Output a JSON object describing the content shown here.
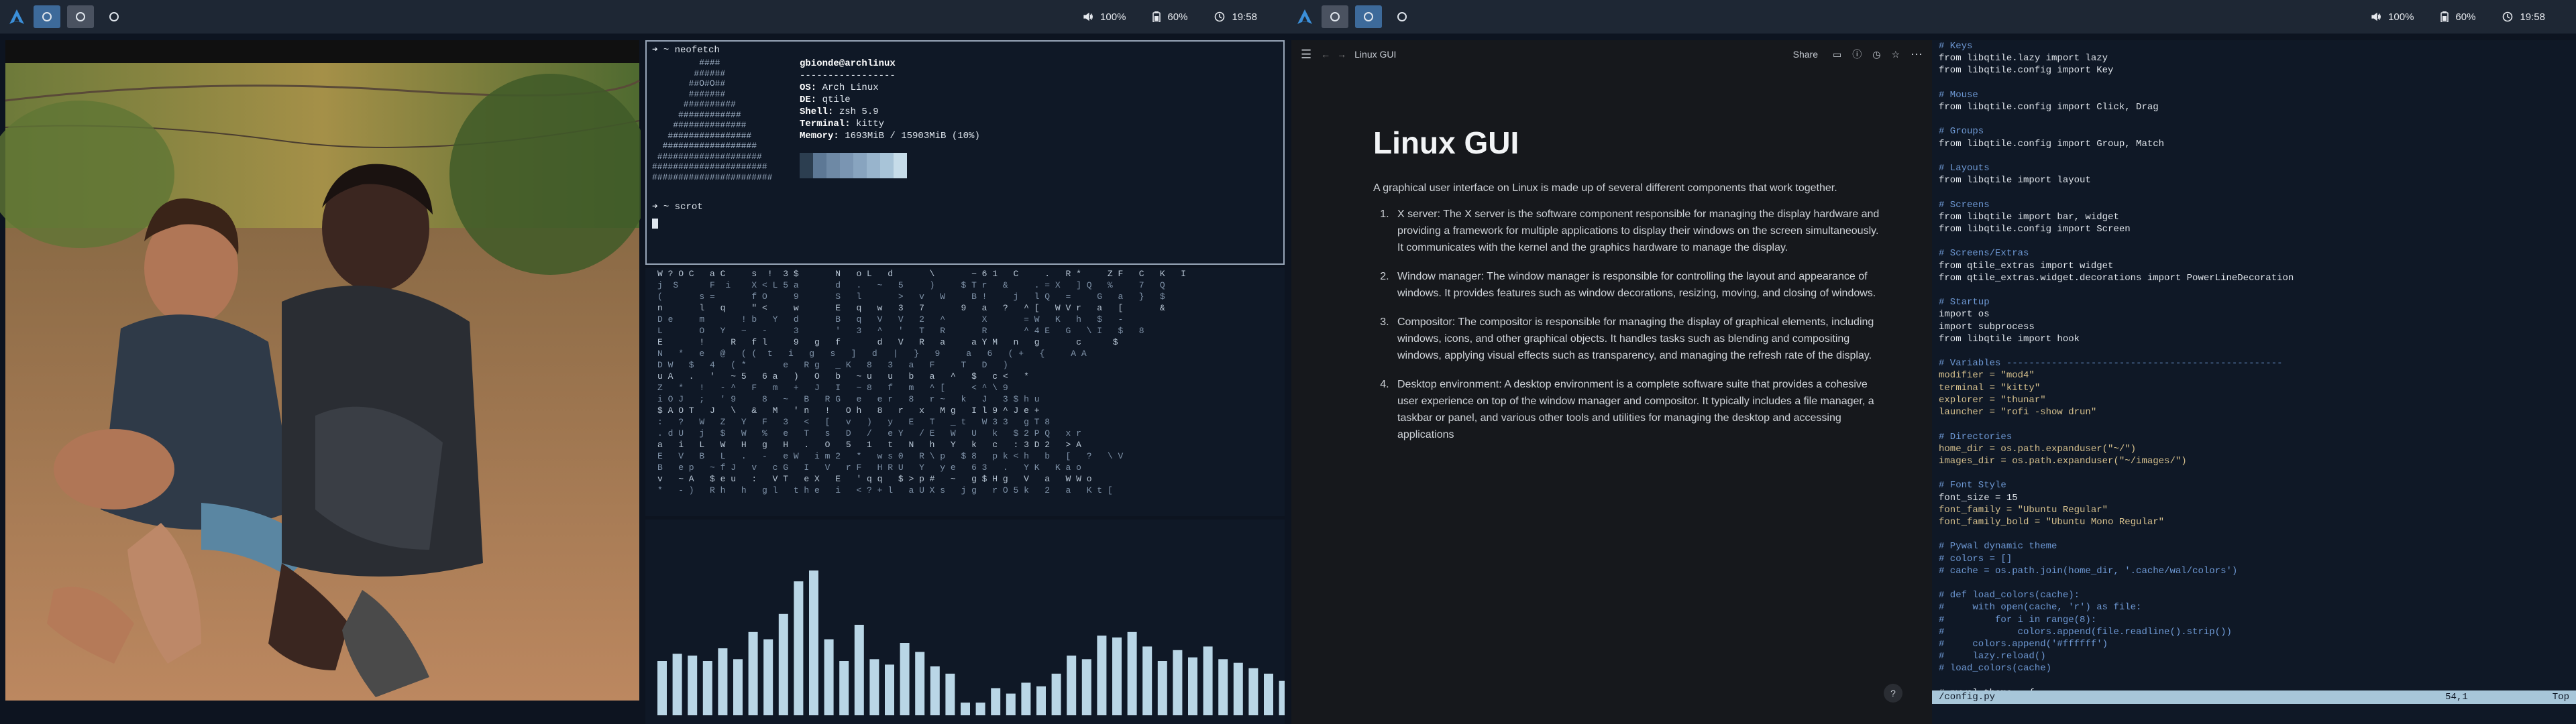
{
  "bar_left": {
    "workspaces": [
      "ws-1",
      "ws-2",
      "ws-3"
    ],
    "volume": "100%",
    "battery": "60%",
    "clock": "19:58"
  },
  "bar_right": {
    "workspaces": [
      "ws-1",
      "ws-2",
      "ws-3"
    ],
    "volume": "100%",
    "battery": "60%",
    "clock": "19:58"
  },
  "terminal": {
    "cmd1": "➜  ~ neofetch",
    "user_host": "gbionde@archlinux",
    "separator": "-----------------",
    "os_label": "OS:",
    "os": "Arch Linux",
    "de_label": "DE:",
    "de": "qtile",
    "shell_label": "Shell:",
    "shell": "zsh 5.9",
    "term_label": "Terminal:",
    "term_val": "kitty",
    "mem_label": "Memory:",
    "mem": "1693MiB / 15903MiB (10%)",
    "cmd2": "➜  ~ scrot",
    "swatches": [
      "#2c3e50",
      "#5d7895",
      "#6e89a5",
      "#7a95b2",
      "#88a4bf",
      "#98b4cc",
      "#a8c4d8",
      "#c6dce9"
    ]
  },
  "matrix_lines": [
    "W ? O C   a C     s  !  3 $       N   o L   d       \\       ~ 6 1   C     .   R *     Z F   C   K   I",
    "j  S      F  i    X < L 5 a       d   .   ~   5     )     $ T r   &     . = X   ] Q   %     7   Q",
    "(       s =       f O     9       S   l       >   v   W     B !     j   l Q   =     G   a   }   $",
    "n       l   q     \" <     w       E   q   w   3   7       9   a   ?   ^ [   W V r   a   [       &",
    "D e     m       ! b   Y   d       B   q   V   V   2   ^       X       = W   K   h   $   -",
    "L       O   Y   ~   -     3       '   3   ^   '   T   R       R       ^ 4 E   G   \\ I   $   8",
    "E       !     R   f l     9   g   f       d   V   R   a     a Y M   n   g       c      $",
    "N   *   e   @   ( (  t   i   g   s   ]   d   |   }   9     a   6   ( +   {     A A",
    "D W   $   4   ( *       e   R g   _ K   8   3   a   F     T   D   )",
    "u A   .   '   ~ 5   6 a   )   O   b   ~ u   u   b   a   ^   $   c <   *",
    "Z   *   !   - ^   F   m   +   J   I   ~ 8   f   m   ^ [     < ^ \\ 9",
    "i O J   ;   ' 9     8   ~   B   R G   e   e r   8   r ~   k   J   3 $ h u",
    "$ A O T   J   \\   &   M   ' n   !   O h   8   r   x   M g   I l 9 ^ J e +",
    ":   ?   W   Z   Y   F   3   <   [   v   )   y   E   T   _ t   W 3 3   g T 8",
    ". d U   j   $   W   %   e   T   s   D   /   e Y   / E   W   U   k   $ 2 P Q   x r",
    "a   i   L   W   H   g   H   .   O   5   1   t   N   h   Y   k   c   : 3 D 2   > A",
    "E   V   B   L   .   -   e W   i m 2   *   w s 0   R \\ p   $ 8   p k < h   b   [   ?   \\ V",
    "B   e p   ~ f J   v   c G   I   V   r F   H R U   Y   y e   6 3   .   Y K   K a o",
    "v   ~ A   $ e u   :   V T   e X   E   ' q q   $ > p #   ~   g $ H g   V   a   W W o",
    "*   - )   R h   h   g l   t h e   i   < ? + l   a U X s   j g   r O 5 k   2   a   K t ["
  ],
  "viz_bars": [
    0.3,
    0.34,
    0.33,
    0.3,
    0.37,
    0.31,
    0.46,
    0.42,
    0.56,
    0.74,
    0.8,
    0.42,
    0.3,
    0.5,
    0.31,
    0.28,
    0.4,
    0.35,
    0.27,
    0.23,
    0.07,
    0.07,
    0.15,
    0.12,
    0.18,
    0.16,
    0.23,
    0.33,
    0.31,
    0.44,
    0.43,
    0.46,
    0.38,
    0.3,
    0.36,
    0.32,
    0.38,
    0.31,
    0.29,
    0.26,
    0.23,
    0.19
  ],
  "notes": {
    "breadcrumb": "Linux GUI",
    "share": "Share",
    "title": "Linux GUI",
    "intro": "A graphical user interface on Linux is made up of several different components that work together.",
    "items": [
      "X server: The X server is the software component responsible for managing the display hardware and providing a framework for multiple applications to display their windows on the screen simultaneously. It communicates with the kernel and the graphics hardware to manage the display.",
      "Window manager: The window manager is responsible for controlling the layout and appearance of windows. It provides features such as window decorations, resizing, moving, and closing of windows.",
      "Compositor: The compositor is responsible for managing the display of graphical elements, including windows, icons, and other graphical objects. It handles tasks such as blending and compositing windows, applying visual effects such as transparency, and managing the refresh rate of the display.",
      "Desktop environment: A desktop environment is a complete software suite that provides a cohesive user experience on top of the window manager and compositor. It typically includes a file manager, a taskbar or panel, and various other tools and utilities for managing the desktop and accessing applications"
    ],
    "help": "?"
  },
  "editor": {
    "lines": [
      [
        "cm",
        "# Keys"
      ],
      [
        "kw",
        "from libqtile.lazy import lazy"
      ],
      [
        "kw",
        "from libqtile.config import Key"
      ],
      [
        "kw",
        ""
      ],
      [
        "cm",
        "# Mouse"
      ],
      [
        "kw",
        "from libqtile.config import Click, Drag"
      ],
      [
        "kw",
        ""
      ],
      [
        "cm",
        "# Groups"
      ],
      [
        "kw",
        "from libqtile.config import Group, Match"
      ],
      [
        "kw",
        ""
      ],
      [
        "cm",
        "# Layouts"
      ],
      [
        "kw",
        "from libqtile import layout"
      ],
      [
        "kw",
        ""
      ],
      [
        "cm",
        "# Screens"
      ],
      [
        "kw",
        "from libqtile import bar, widget"
      ],
      [
        "kw",
        "from libqtile.config import Screen"
      ],
      [
        "kw",
        ""
      ],
      [
        "cm",
        "# Screens/Extras"
      ],
      [
        "kw",
        "from qtile_extras import widget"
      ],
      [
        "kw",
        "from qtile_extras.widget.decorations import PowerLineDecoration"
      ],
      [
        "kw",
        ""
      ],
      [
        "cm",
        "# Startup"
      ],
      [
        "kw",
        "import os"
      ],
      [
        "kw",
        "import subprocess"
      ],
      [
        "kw",
        "from libqtile import hook"
      ],
      [
        "kw",
        ""
      ],
      [
        "cm",
        "# Variables -------------------------------------------------"
      ],
      [
        "st",
        "modifier = \"mod4\""
      ],
      [
        "st",
        "terminal = \"kitty\""
      ],
      [
        "st",
        "explorer = \"thunar\""
      ],
      [
        "st",
        "launcher = \"rofi -show drun\""
      ],
      [
        "kw",
        ""
      ],
      [
        "cm",
        "# Directories"
      ],
      [
        "st",
        "home_dir = os.path.expanduser(\"~/\")"
      ],
      [
        "st",
        "images_dir = os.path.expanduser(\"~/images/\")"
      ],
      [
        "kw",
        ""
      ],
      [
        "cm",
        "# Font Style"
      ],
      [
        "kw",
        "font_size = 15"
      ],
      [
        "st",
        "font_family = \"Ubuntu Regular\""
      ],
      [
        "st",
        "font_family_bold = \"Ubuntu Mono Regular\""
      ],
      [
        "kw",
        ""
      ],
      [
        "cm",
        "# Pywal dynamic theme"
      ],
      [
        "cm",
        "# colors = []"
      ],
      [
        "cm",
        "# cache = os.path.join(home_dir, '.cache/wal/colors')"
      ],
      [
        "kw",
        ""
      ],
      [
        "cm",
        "# def load_colors(cache):"
      ],
      [
        "cm",
        "#     with open(cache, 'r') as file:"
      ],
      [
        "cm",
        "#         for i in range(8):"
      ],
      [
        "cm",
        "#             colors.append(file.readline().strip())"
      ],
      [
        "cm",
        "#     colors.append('#ffffff')"
      ],
      [
        "cm",
        "#     lazy.reload()"
      ],
      [
        "cm",
        "# load_colors(cache)"
      ],
      [
        "kw",
        ""
      ],
      [
        "kw",
        "# pywal_theme = {"
      ]
    ],
    "status_file": "/config.py",
    "status_pos": "54,1",
    "status_scroll": "Top"
  }
}
